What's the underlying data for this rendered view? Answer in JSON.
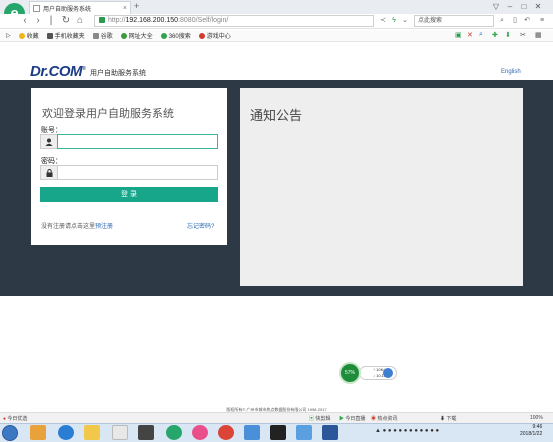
{
  "browser": {
    "tab_title": "用户自助服务系统",
    "tab_close": "×",
    "new_tab": "+",
    "address_scheme": "http://",
    "address_host": "192.168.200.150",
    "address_rest": ":8080/Self/login/",
    "search_placeholder": "点此搜索",
    "bookmarks": [
      {
        "label": "收藏",
        "icon": "star-icon",
        "color": "#f2b21b"
      },
      {
        "label": "手机收藏夹",
        "icon": "phone-icon",
        "color": "#555555"
      },
      {
        "label": "谷歌",
        "icon": "page-icon",
        "color": "#888888"
      },
      {
        "label": "网址大全",
        "icon": "grid-icon",
        "color": "#3b9a3b"
      },
      {
        "label": "360搜索",
        "icon": "search-icon",
        "color": "#2ea44f"
      },
      {
        "label": "游戏中心",
        "icon": "game-icon",
        "color": "#d33a2c"
      }
    ]
  },
  "header": {
    "logo_text": "Dr.COM",
    "logo_mark": "®",
    "brand_name": "用户自助服务系统",
    "language_link": "English"
  },
  "login": {
    "title": "欢迎登录用户自助服务系统",
    "username_label": "账号：",
    "username_value": "",
    "password_label": "密码：",
    "password_value": "",
    "submit_label": "登 录",
    "register_text": "没有注册请点击这里",
    "register_link": "预注册",
    "forgot_link": "忘记密码?"
  },
  "notice": {
    "title": "通知公告"
  },
  "speed_widget": {
    "percent": "57%",
    "up": "10K/s",
    "down": "10.1K/s"
  },
  "footer": {
    "copyright": "版权所有© 广州市城市热点数据股份有限公司 1998-2017"
  },
  "statusbar": {
    "left": "今日优选",
    "items": [
      "快剪辑",
      "今日直播",
      "热点资讯"
    ],
    "download": "下载",
    "zoom": "100%"
  },
  "taskbar": {
    "time": "9:46",
    "date": "2018/1/22"
  },
  "colors": {
    "dark_band": "#2d3a45",
    "accent": "#17a689",
    "brand_blue": "#1b3c85"
  }
}
